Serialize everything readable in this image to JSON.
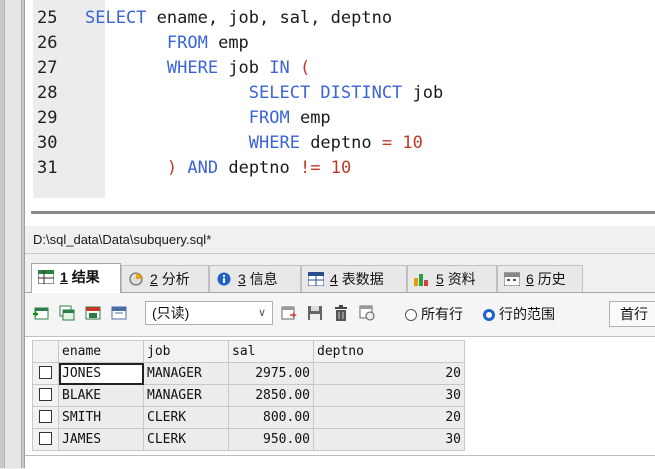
{
  "editor": {
    "lines": [
      {
        "n": "25",
        "tokens": [
          {
            "t": "kw",
            "v": "SELECT"
          },
          {
            "t": "p",
            "v": " ename, job, sal, deptno"
          }
        ]
      },
      {
        "n": "26",
        "tokens": [
          {
            "t": "p",
            "v": "        "
          },
          {
            "t": "kw",
            "v": "FROM"
          },
          {
            "t": "p",
            "v": " emp"
          }
        ]
      },
      {
        "n": "27",
        "tokens": [
          {
            "t": "p",
            "v": "        "
          },
          {
            "t": "kw",
            "v": "WHERE"
          },
          {
            "t": "p",
            "v": " job "
          },
          {
            "t": "kw",
            "v": "IN"
          },
          {
            "t": "p",
            "v": " "
          },
          {
            "t": "op",
            "v": "("
          }
        ]
      },
      {
        "n": "28",
        "tokens": [
          {
            "t": "p",
            "v": "                "
          },
          {
            "t": "kw",
            "v": "SELECT DISTINCT"
          },
          {
            "t": "p",
            "v": " job"
          }
        ]
      },
      {
        "n": "29",
        "tokens": [
          {
            "t": "p",
            "v": "                "
          },
          {
            "t": "kw",
            "v": "FROM"
          },
          {
            "t": "p",
            "v": " emp"
          }
        ]
      },
      {
        "n": "30",
        "tokens": [
          {
            "t": "p",
            "v": "                "
          },
          {
            "t": "kw",
            "v": "WHERE"
          },
          {
            "t": "p",
            "v": " deptno "
          },
          {
            "t": "op",
            "v": "="
          },
          {
            "t": "p",
            "v": " "
          },
          {
            "t": "num",
            "v": "10"
          }
        ]
      },
      {
        "n": "31",
        "tokens": [
          {
            "t": "p",
            "v": "        "
          },
          {
            "t": "op",
            "v": ")"
          },
          {
            "t": "p",
            "v": " "
          },
          {
            "t": "kw",
            "v": "AND"
          },
          {
            "t": "p",
            "v": " deptno "
          },
          {
            "t": "op",
            "v": "!="
          },
          {
            "t": "p",
            "v": " "
          },
          {
            "t": "num",
            "v": "10"
          }
        ]
      }
    ]
  },
  "file_path": "D:\\sql_data\\Data\\subquery.sql*",
  "tabs": [
    {
      "num": "1",
      "label": "结果",
      "icon": "results-grid-icon",
      "active": true
    },
    {
      "num": "2",
      "label": "分析",
      "icon": "profiler-icon",
      "active": false
    },
    {
      "num": "3",
      "label": "信息",
      "icon": "info-icon",
      "active": false
    },
    {
      "num": "4",
      "label": "表数据",
      "icon": "table-data-icon",
      "active": false
    },
    {
      "num": "5",
      "label": "资料",
      "icon": "profile-chart-icon",
      "active": false
    },
    {
      "num": "6",
      "label": "历史",
      "icon": "history-calendar-icon",
      "active": false
    }
  ],
  "toolbar": {
    "mode_value": "(只读)",
    "radio_all_rows": "所有行",
    "radio_row_range": "行的范围",
    "first_row_label": "首行"
  },
  "grid": {
    "columns": [
      "ename",
      "job",
      "sal",
      "deptno"
    ],
    "rows": [
      [
        "JONES",
        "MANAGER",
        "2975.00",
        "20"
      ],
      [
        "BLAKE",
        "MANAGER",
        "2850.00",
        "30"
      ],
      [
        "SMITH",
        "CLERK",
        "800.00",
        "20"
      ],
      [
        "JAMES",
        "CLERK",
        "950.00",
        "30"
      ]
    ]
  },
  "colors": {
    "keyword": "#3b64d8",
    "number": "#c0392b",
    "radio_accent": "#1e62c9"
  }
}
